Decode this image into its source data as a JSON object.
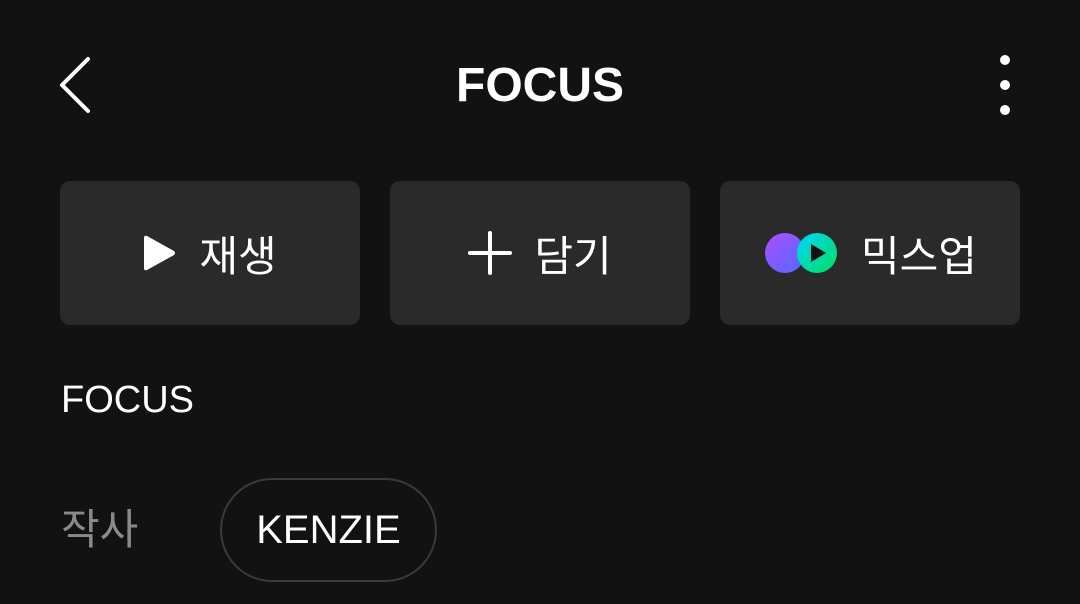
{
  "header": {
    "title": "FOCUS",
    "back_icon": "chevron-left-icon",
    "more_icon": "more-vertical-icon"
  },
  "actions": {
    "play_label": "재생",
    "add_label": "담기",
    "mixup_label": "믹스업"
  },
  "song": {
    "title": "FOCUS"
  },
  "credits": {
    "role_label": "작사",
    "name": "KENZIE"
  },
  "colors": {
    "background": "#121212",
    "button_bg": "#2a2a2a",
    "text_primary": "#ffffff",
    "text_secondary": "#8a8a8a",
    "mixup_purple": "#8a4dff",
    "mixup_green": "#00e05a"
  }
}
